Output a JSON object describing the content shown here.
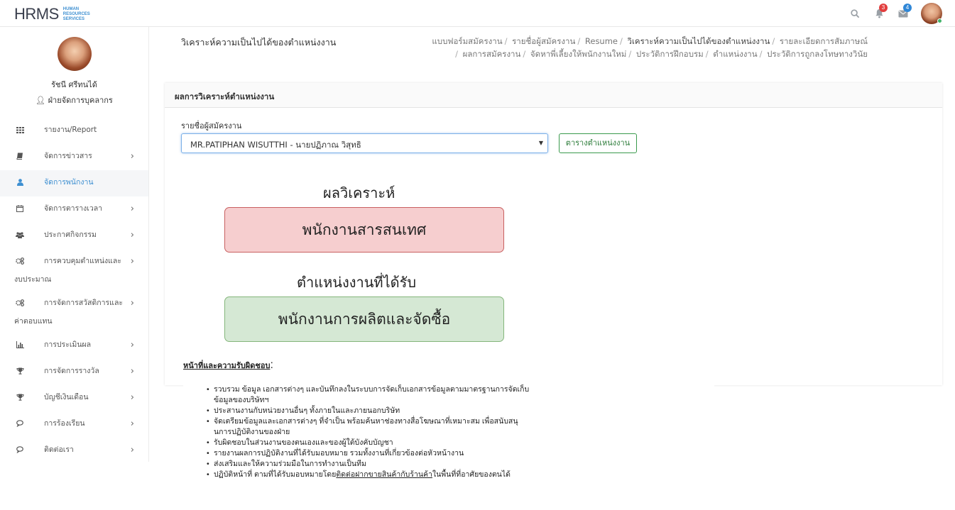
{
  "header": {
    "logo_main": "HRMS",
    "logo_sub_1": "HUMAN",
    "logo_sub_2": "RESOURCES",
    "logo_sub_3": "SERVICES",
    "notifications_count": "3",
    "messages_count": "4",
    "icons": [
      "search-icon",
      "bell-icon",
      "envelope-icon",
      "user-avatar"
    ]
  },
  "profile": {
    "name": "รัชนี ศรีทนได้",
    "role": "ฝ่ายจัดการบุคลากร"
  },
  "sidebar": {
    "items": [
      {
        "label": "รายงาน/Report",
        "icon": "grid-icon",
        "chevron": false
      },
      {
        "label": "จัดการข่าวสาร",
        "icon": "book-icon",
        "chevron": true
      },
      {
        "label": "จัดการพนักงาน",
        "icon": "user-icon",
        "chevron": false,
        "active": true
      },
      {
        "label": "จัดการตารางเวลา",
        "icon": "calendar-icon",
        "chevron": true
      },
      {
        "label": "ประกาศกิจกรรม",
        "icon": "users-icon",
        "chevron": true
      },
      {
        "label": "การควบคุมตำแหน่งและ",
        "label_cont": "งบประมาณ",
        "icon": "cogs-icon",
        "chevron": true
      },
      {
        "label": "การจัดการสวัสดิการและ",
        "label_cont": "ค่าตอบแทน",
        "icon": "cogs-icon",
        "chevron": true
      },
      {
        "label": "การประเมินผล",
        "icon": "bar-chart-icon",
        "chevron": true
      },
      {
        "label": "การจัดการรางวัล",
        "icon": "trophy-icon",
        "chevron": true
      },
      {
        "label": "บัญชีเงินเดือน",
        "icon": "trophy-icon",
        "chevron": true
      },
      {
        "label": "การร้องเรียน",
        "icon": "comments-icon",
        "chevron": true
      },
      {
        "label": "ติดต่อเรา",
        "icon": "comments-icon",
        "chevron": true
      }
    ]
  },
  "page": {
    "title": "วิเคราะห์ความเป็นไปได้ของตำแหน่งงาน",
    "breadcrumb_line1": [
      "แบบฟอร์มสมัครงาน",
      "รายชื่อผู้สมัครงาน",
      "Resume",
      "วิเคราะห์ความเป็นไปได้ของตำแหน่งงาน",
      "รายละเอียดการสัมภาษณ์"
    ],
    "breadcrumb_line2": [
      "ผลการสมัครงาน",
      "จัดหาพี่เลี้ยงให้พนักงานใหม่",
      "ประวัติการฝึกอบรม",
      "ตำแหน่งงาน",
      "ประวัติการถูกลงโทษทางวินัย"
    ]
  },
  "card": {
    "title": "ผลการวิเคราะห์ตำแหน่งงาน",
    "field_label": "รายชื่อผู้สมัครงาน",
    "selected_applicant": "MR.PATIPHAN WISUTTHI - นายปฏิภาณ วิสุทธิ",
    "table_button": "ตารางตำแหน่งงาน",
    "analysis_heading": "ผลวิเคราะห์",
    "analysis_result": "พนักงานสารสนเทศ",
    "received_heading": "ตำแหน่งงานที่ได้รับ",
    "received_position": "พนักงานการผลิตและจัดซื้อ"
  },
  "duties": {
    "title": "หน้าที่และความรับผิดชอบ",
    "title_suffix": ":",
    "items": [
      "รวบรวม ข้อมูล เอกสารต่างๆ และบันทึกลงในระบบการจัดเก็บเอกสารข้อมูลตามมาตรฐานการจัดเก็บ",
      "ข้อมูลของบริษัทฯ",
      "ประสานงานกับหน่วยงานอื่นๆ ทั้งภายในและภายนอกบริษัท",
      "จัดเตรียมข้อมูลและเอกสารต่างๆ ที่จำเป็น พร้อมค้นหาช่องทางสื่อโฆษณาที่เหมาะสม เพื่อสนับสนุ",
      "นการปฏิบัติงานของฝ่าย",
      "รับผิดชอบในส่วนงานของตนเองและของผู้ใต้บังคับบัญชา",
      "รายงานผลการปฏิบัติงานที่ได้รับมอบหมาย รวมทั้งงานที่เกี่ยวข้องต่อหัวหน้างาน",
      "ส่งเสริมและให้ความร่วมมือในการทำงานเป็นทีม",
      "ปฏิบัติหน้าที่ ตามที่ได้รับมอบหมายโดย",
      "ติดต่อฝากขายสินค้ากับร้านค้า",
      "ในพื้นที่ที่อาศัยของตนได้"
    ]
  }
}
